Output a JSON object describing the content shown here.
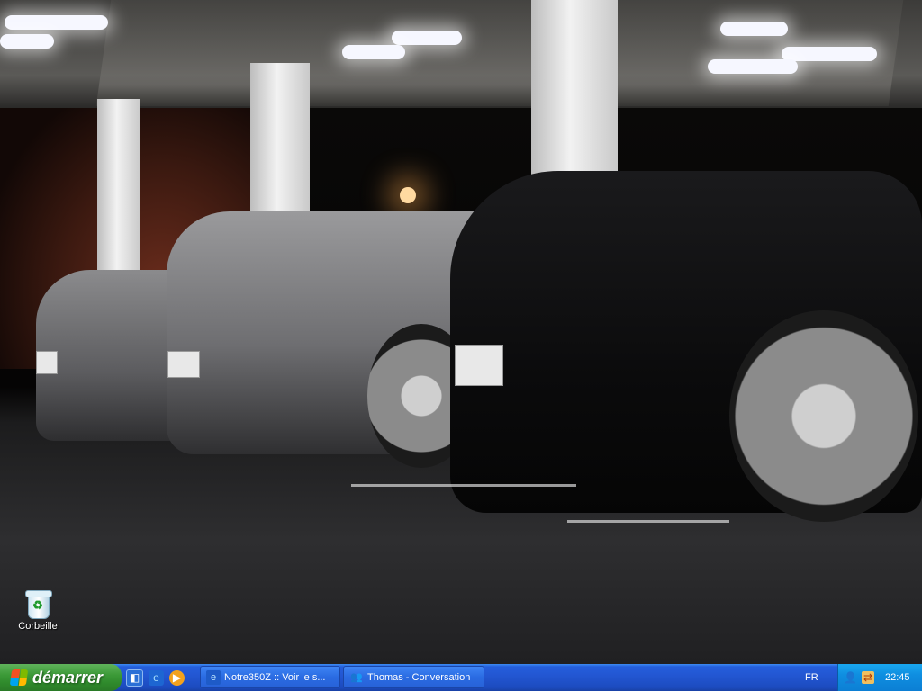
{
  "desktop": {
    "icons": [
      {
        "label": "Corbeille",
        "icon": "recycle-bin-icon"
      }
    ]
  },
  "taskbar": {
    "start_label": "démarrer",
    "quick_launch": [
      {
        "icon": "show-desktop-icon"
      },
      {
        "icon": "internet-explorer-icon"
      },
      {
        "icon": "media-player-icon"
      }
    ],
    "tasks": [
      {
        "label": "Notre350Z :: Voir le s...",
        "icon": "internet-explorer-icon"
      },
      {
        "label": "Thomas - Conversation",
        "icon": "msn-messenger-icon"
      }
    ],
    "language": "FR",
    "tray_icons": [
      "msn-messenger-icon",
      "network-icon"
    ],
    "clock": "22:45"
  },
  "colors": {
    "taskbar_blue": "#245edb",
    "start_green": "#3c9a38",
    "tray_blue": "#0f8ee0"
  }
}
